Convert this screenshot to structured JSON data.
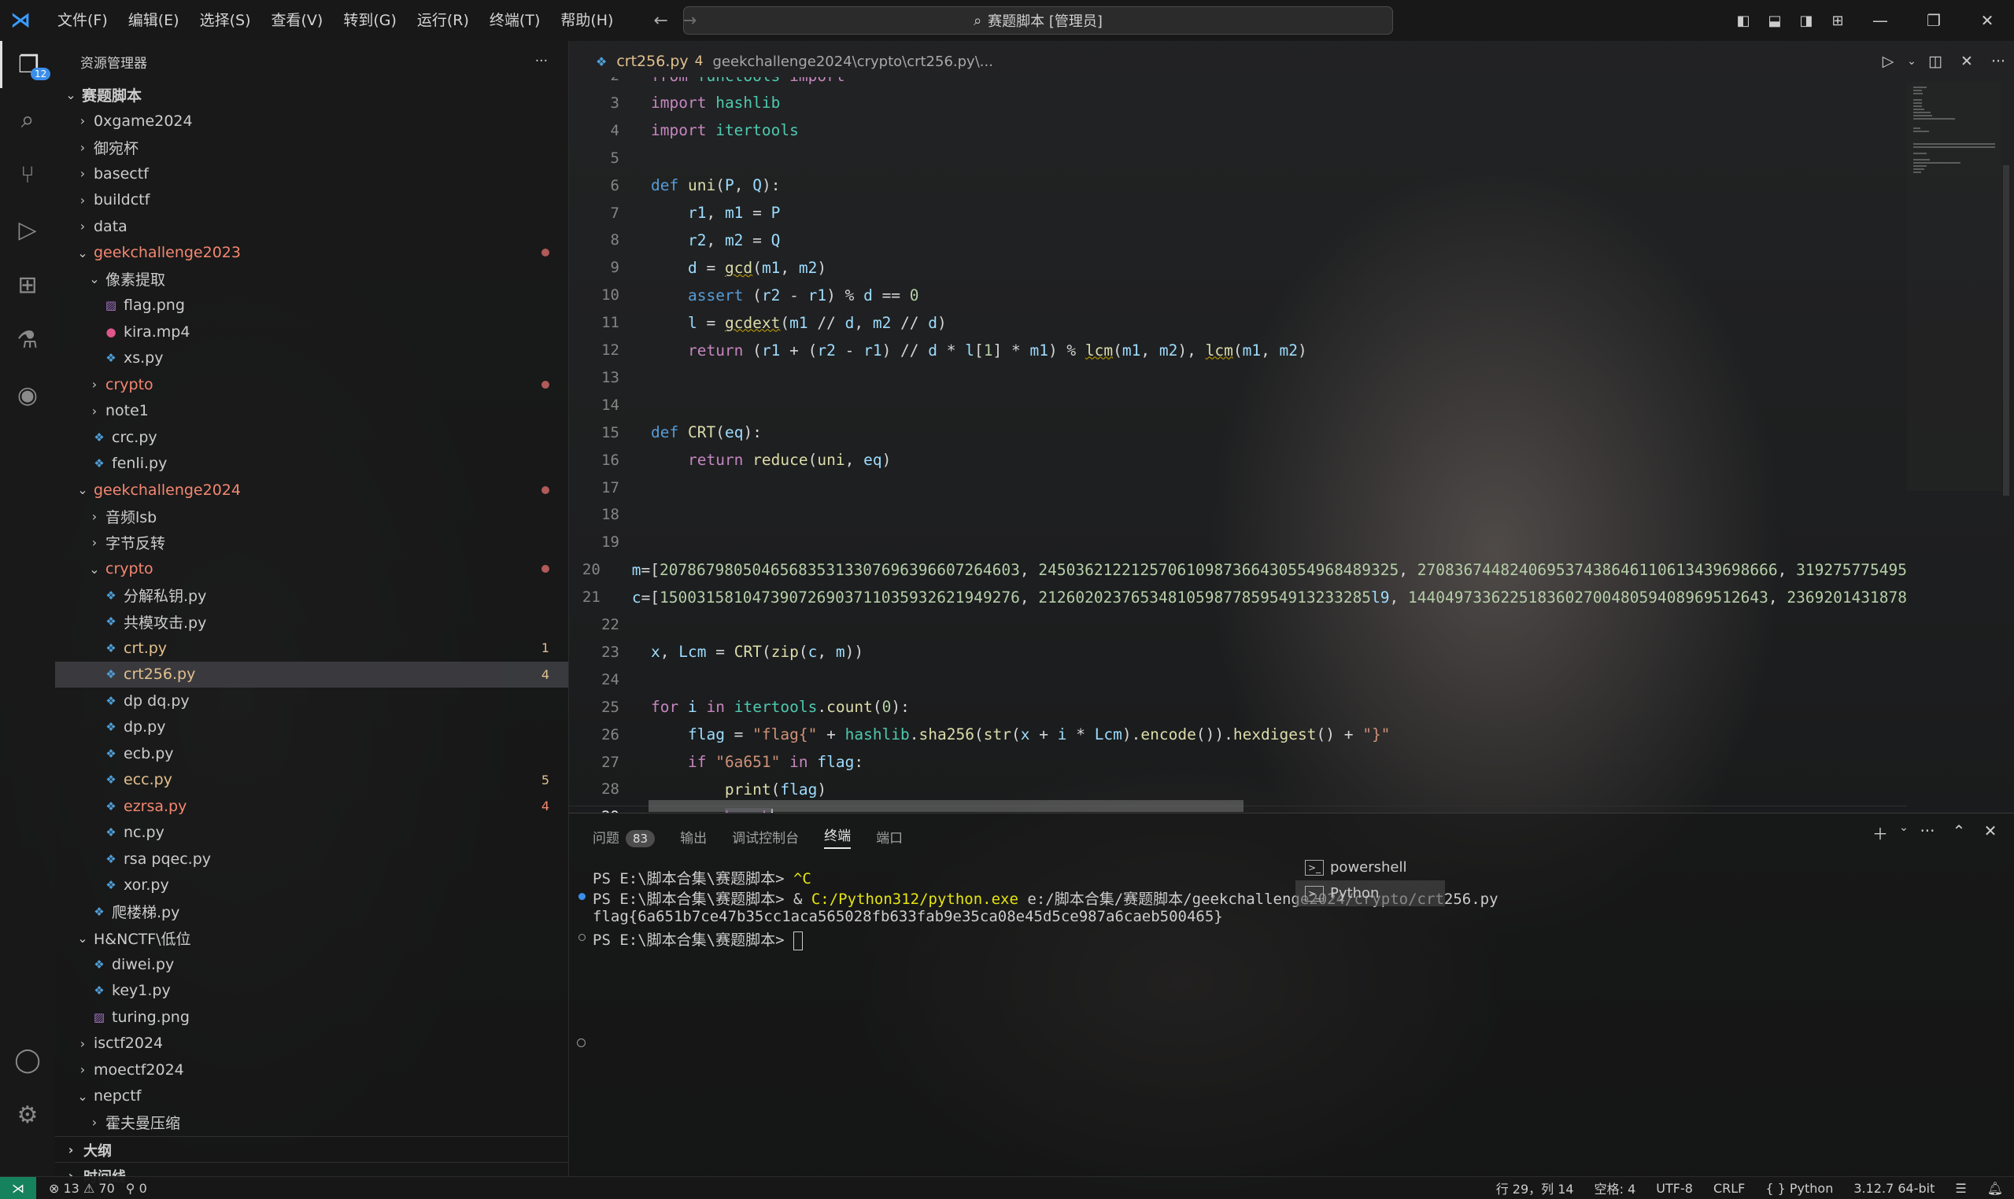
{
  "titlebar": {
    "menu": [
      "文件(F)",
      "编辑(E)",
      "选择(S)",
      "查看(V)",
      "转到(G)",
      "运行(R)",
      "终端(T)",
      "帮助(H)"
    ],
    "search": "赛题脚本 [管理员]"
  },
  "activity": {
    "explorer_badge": "12"
  },
  "sidebar": {
    "title": "资源管理器",
    "more": "···",
    "root": "赛题脚本",
    "items": [
      {
        "label": "0xgame2024",
        "depth": 1,
        "kind": "folder",
        "open": false
      },
      {
        "label": "御宛杯",
        "depth": 1,
        "kind": "folder",
        "open": false
      },
      {
        "label": "basectf",
        "depth": 1,
        "kind": "folder",
        "open": false
      },
      {
        "label": "buildctf",
        "depth": 1,
        "kind": "folder",
        "open": false
      },
      {
        "label": "data",
        "depth": 1,
        "kind": "folder",
        "open": false
      },
      {
        "label": "geekchallenge2023",
        "depth": 1,
        "kind": "folder",
        "open": true,
        "state": "err",
        "dot": true
      },
      {
        "label": "像素提取",
        "depth": 2,
        "kind": "folder",
        "open": true
      },
      {
        "label": "flag.png",
        "depth": 3,
        "kind": "img"
      },
      {
        "label": "kira.mp4",
        "depth": 3,
        "kind": "vid"
      },
      {
        "label": "xs.py",
        "depth": 3,
        "kind": "py"
      },
      {
        "label": "crypto",
        "depth": 2,
        "kind": "folder",
        "open": false,
        "state": "err",
        "dot": true
      },
      {
        "label": "note1",
        "depth": 2,
        "kind": "folder",
        "open": false
      },
      {
        "label": "crc.py",
        "depth": 2,
        "kind": "py"
      },
      {
        "label": "fenli.py",
        "depth": 2,
        "kind": "py"
      },
      {
        "label": "geekchallenge2024",
        "depth": 1,
        "kind": "folder",
        "open": true,
        "state": "err",
        "dot": true
      },
      {
        "label": "音频lsb",
        "depth": 2,
        "kind": "folder",
        "open": false
      },
      {
        "label": "字节反转",
        "depth": 2,
        "kind": "folder",
        "open": false
      },
      {
        "label": "crypto",
        "depth": 2,
        "kind": "folder",
        "open": true,
        "state": "err",
        "dot": true
      },
      {
        "label": "分解私钥.py",
        "depth": 3,
        "kind": "py"
      },
      {
        "label": "共模攻击.py",
        "depth": 3,
        "kind": "py"
      },
      {
        "label": "crt.py",
        "depth": 3,
        "kind": "py",
        "state": "mod",
        "count": "1"
      },
      {
        "label": "crt256.py",
        "depth": 3,
        "kind": "py",
        "state": "mod",
        "count": "4",
        "selected": true
      },
      {
        "label": "dp dq.py",
        "depth": 3,
        "kind": "py"
      },
      {
        "label": "dp.py",
        "depth": 3,
        "kind": "py"
      },
      {
        "label": "ecb.py",
        "depth": 3,
        "kind": "py"
      },
      {
        "label": "ecc.py",
        "depth": 3,
        "kind": "py",
        "state": "mod",
        "count": "5"
      },
      {
        "label": "ezrsa.py",
        "depth": 3,
        "kind": "py",
        "state": "err",
        "count": "4"
      },
      {
        "label": "nc.py",
        "depth": 3,
        "kind": "py"
      },
      {
        "label": "rsa pqec.py",
        "depth": 3,
        "kind": "py"
      },
      {
        "label": "xor.py",
        "depth": 3,
        "kind": "py"
      },
      {
        "label": "爬楼梯.py",
        "depth": 2,
        "kind": "py"
      },
      {
        "label": "H&NCTF\\低位",
        "depth": 1,
        "kind": "folder",
        "open": true
      },
      {
        "label": "diwei.py",
        "depth": 2,
        "kind": "py"
      },
      {
        "label": "key1.py",
        "depth": 2,
        "kind": "py"
      },
      {
        "label": "turing.png",
        "depth": 2,
        "kind": "img"
      },
      {
        "label": "isctf2024",
        "depth": 1,
        "kind": "folder",
        "open": false
      },
      {
        "label": "moectf2024",
        "depth": 1,
        "kind": "folder",
        "open": false
      },
      {
        "label": "nepctf",
        "depth": 1,
        "kind": "folder",
        "open": true
      },
      {
        "label": "霍夫曼压缩",
        "depth": 2,
        "kind": "folder",
        "open": false
      }
    ],
    "outline": "大纲",
    "timeline": "时间线"
  },
  "editor": {
    "tab": {
      "name": "crt256.py",
      "count": "4",
      "path": "geekchallenge2024\\crypto\\crt256.py\\..."
    },
    "current_line": "29",
    "lines": [
      {
        "n": "2",
        "code": "from functools import *"
      },
      {
        "n": "3",
        "code": "import hashlib"
      },
      {
        "n": "4",
        "code": "import itertools"
      },
      {
        "n": "5",
        "code": ""
      },
      {
        "n": "6",
        "code": "def uni(P, Q):"
      },
      {
        "n": "7",
        "code": "    r1, m1 = P"
      },
      {
        "n": "8",
        "code": "    r2, m2 = Q"
      },
      {
        "n": "9",
        "code": "    d = gcd(m1, m2)"
      },
      {
        "n": "10",
        "code": "    assert (r2 - r1) % d == 0"
      },
      {
        "n": "11",
        "code": "    l = gcdext(m1 // d, m2 // d)"
      },
      {
        "n": "12",
        "code": "    return (r1 + (r2 - r1) // d * l[1] * m1) % lcm(m1, m2), lcm(m1, m2)"
      },
      {
        "n": "13",
        "code": ""
      },
      {
        "n": "14",
        "code": ""
      },
      {
        "n": "15",
        "code": "def CRT(eq):"
      },
      {
        "n": "16",
        "code": "    return reduce(uni, eq)"
      },
      {
        "n": "17",
        "code": ""
      },
      {
        "n": "18",
        "code": ""
      },
      {
        "n": "19",
        "code": ""
      },
      {
        "n": "20",
        "code": "m=[207867980504656835313307696396607264603, 245036212212570610987366430554968489325, 270836744824069537438646110613439698666, 319275775495"
      },
      {
        "n": "21",
        "code": "c=[150031581047390726903711035932621949276, 212602023765348105987785954913233285l9, 144049733622518360270048059408969512643, 2369201431878"
      },
      {
        "n": "22",
        "code": ""
      },
      {
        "n": "23",
        "code": "x, Lcm = CRT(zip(c, m))"
      },
      {
        "n": "24",
        "code": ""
      },
      {
        "n": "25",
        "code": "for i in itertools.count(0):"
      },
      {
        "n": "26",
        "code": "    flag = \"flag{\" + hashlib.sha256(str(x + i * Lcm).encode()).hexdigest() + \"}\""
      },
      {
        "n": "27",
        "code": "    if \"6a651\" in flag:"
      },
      {
        "n": "28",
        "code": "        print(flag)"
      },
      {
        "n": "29",
        "code": "        break"
      }
    ]
  },
  "panel": {
    "tabs": [
      "问题",
      "输出",
      "调试控制台",
      "终端",
      "端口"
    ],
    "problems_count": "83",
    "active_tab": "终端",
    "terminal": [
      {
        "prompt": "PS E:\\脚本合集\\赛题脚本> ",
        "cmd": "^C",
        "deco": ""
      },
      {
        "prompt": "PS E:\\脚本合集\\赛题脚本> & ",
        "exe": "C:/Python312/python.exe",
        "rest": " e:/脚本合集/赛题脚本/geekchallenge2024/crypto/crt256.py",
        "deco": "blue"
      },
      {
        "prompt": "flag{6a651b7ce47b35cc1aca565028fb633fab9e35ca08e45d5ce987a6caeb500465}",
        "deco": ""
      },
      {
        "prompt": "PS E:\\脚本合集\\赛题脚本> ",
        "deco": "hollow",
        "cursor": true
      }
    ],
    "terminals": [
      "powershell",
      "Python"
    ]
  },
  "statusbar": {
    "errors": "13",
    "warnings": "70",
    "ports": "0",
    "position": "行 29，列 14",
    "spaces": "空格: 4",
    "encoding": "UTF-8",
    "eol": "CRLF",
    "language": "Python",
    "interpreter": "3.12.7 64-bit"
  },
  "colors": {
    "accent": "#3b8eea",
    "modified": "#e2c08d",
    "error": "#f48771",
    "remote": "#16825d"
  }
}
